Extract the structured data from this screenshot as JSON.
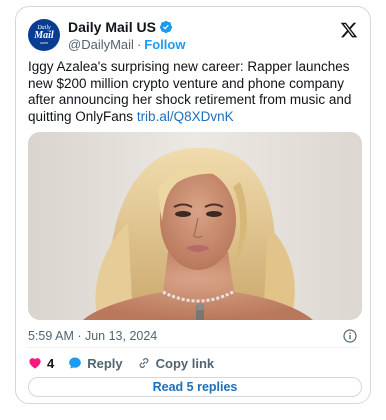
{
  "author": {
    "name": "Daily Mail US",
    "handle": "@DailyMail",
    "separator": "·",
    "follow_label": "Follow",
    "avatar_text": [
      "Daily",
      "Mail",
      "com"
    ]
  },
  "post": {
    "text": "Iggy Azalea's surprising new career: Rapper launches new $200 million crypto venture and phone company after announcing her shock retirement from music and quitting OnlyFans ",
    "link": "trib.al/Q8XDvnK",
    "timestamp": "5:59 AM · Jun 13, 2024"
  },
  "actions": {
    "like_count": "4",
    "reply_label": "Reply",
    "copy_link_label": "Copy link",
    "read_replies_label": "Read 5 replies"
  },
  "colors": {
    "accent": "#1d9bf0",
    "link": "#1d6fb8",
    "like": "#f91880",
    "verified": "#1d9bf0"
  },
  "icons": [
    "verified-badge-icon",
    "x-logo-icon",
    "info-icon",
    "heart-icon",
    "reply-bubble-icon",
    "link-icon"
  ]
}
